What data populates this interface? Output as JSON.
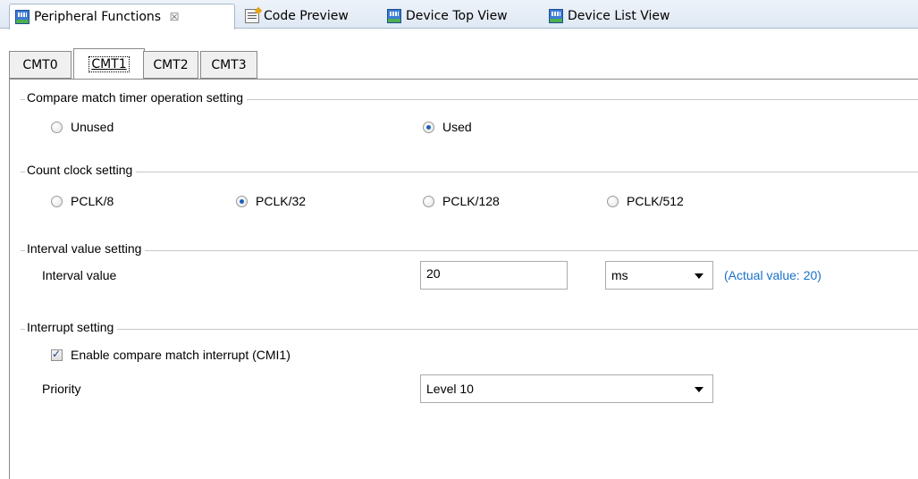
{
  "editor_tabs": [
    {
      "label": "Peripheral Functions",
      "icon": "chip-icon",
      "close": "☒"
    },
    {
      "label": "Code Preview",
      "icon": "code-icon"
    },
    {
      "label": "Device Top View",
      "icon": "chip-icon"
    },
    {
      "label": "Device List View",
      "icon": "chip-icon"
    }
  ],
  "sub_tabs": [
    "CMT0",
    "CMT1",
    "CMT2",
    "CMT3"
  ],
  "sections": {
    "operation": {
      "title": "Compare match timer operation setting",
      "options": [
        "Unused",
        "Used"
      ],
      "selected": "Used"
    },
    "clock": {
      "title": "Count clock setting",
      "options": [
        "PCLK/8",
        "PCLK/32",
        "PCLK/128",
        "PCLK/512"
      ],
      "selected": "PCLK/32"
    },
    "interval": {
      "title": "Interval value setting",
      "label": "Interval value",
      "value": "20",
      "unit": "ms",
      "actual": "(Actual value: 20)"
    },
    "interrupt": {
      "title": "Interrupt setting",
      "checkbox_label": "Enable compare match interrupt (CMI1)",
      "checked": true,
      "priority_label": "Priority",
      "priority_value": "Level 10"
    }
  },
  "colors": {
    "accent": "#1b5fb7",
    "actual_text": "#1a6fc8"
  }
}
